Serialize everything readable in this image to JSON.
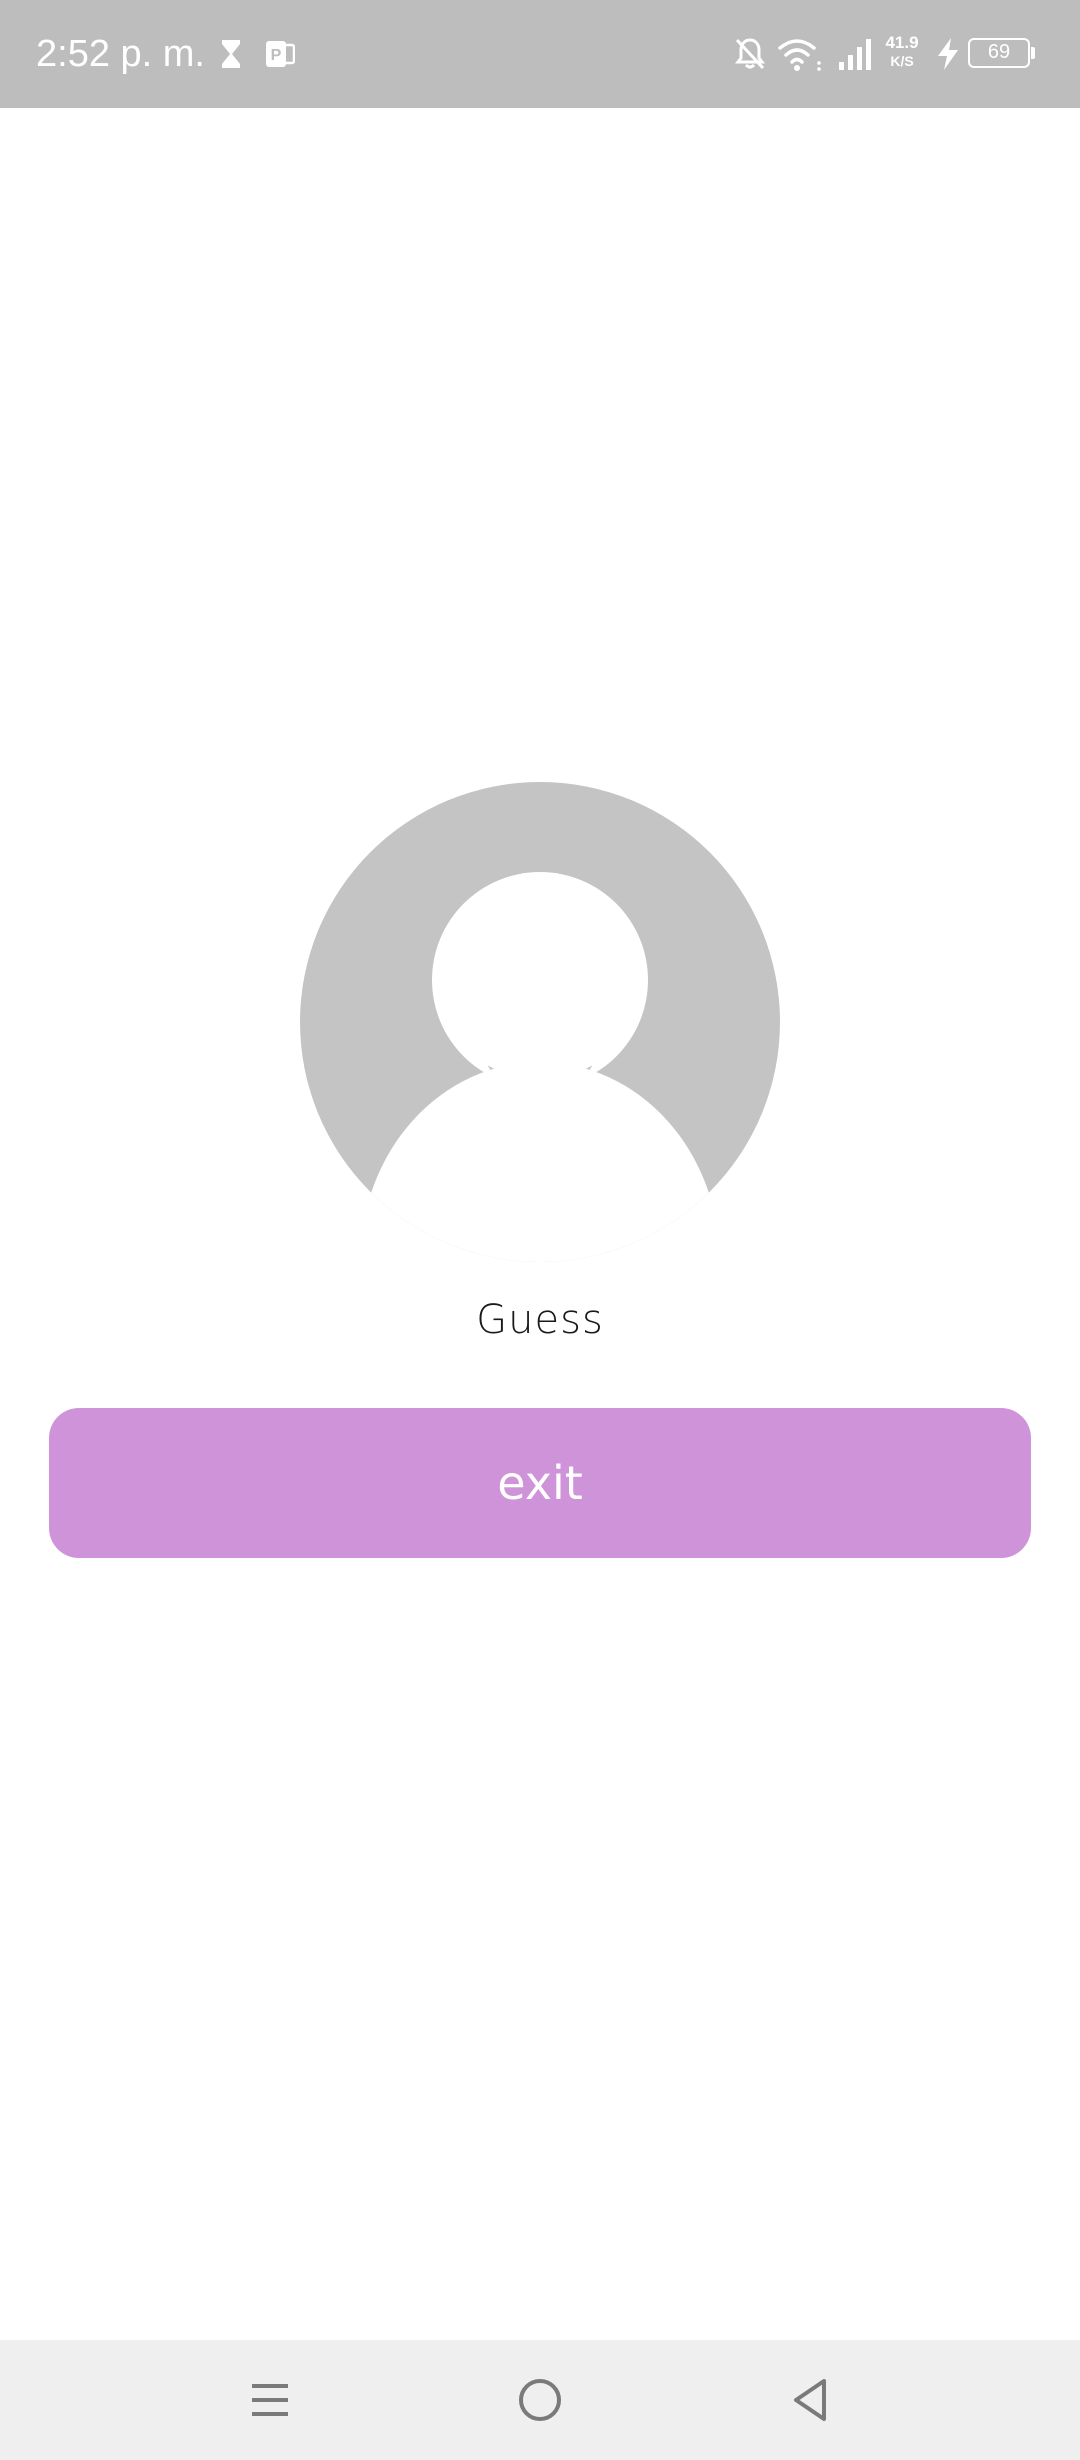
{
  "status_bar": {
    "time": "2:52 p. m.",
    "net_speed_value": "41.9",
    "net_speed_unit": "K/S",
    "battery_level": "69",
    "icons": [
      "hourglass-icon",
      "p-notification-icon",
      "bell-off-icon",
      "wifi-icon",
      "signal-icon",
      "charging-icon",
      "battery-icon"
    ]
  },
  "profile": {
    "avatar_icon": "default-avatar-icon",
    "username": "Guess"
  },
  "actions": {
    "exit_label": "exit"
  },
  "nav_bar": {
    "icons": [
      "menu-icon",
      "home-icon",
      "back-icon"
    ]
  },
  "colors": {
    "status_bar_bg": "#bdbdbd",
    "exit_button_bg": "#ce93d8",
    "avatar_bg": "#c4c4c4",
    "nav_bar_bg": "#efefef"
  }
}
